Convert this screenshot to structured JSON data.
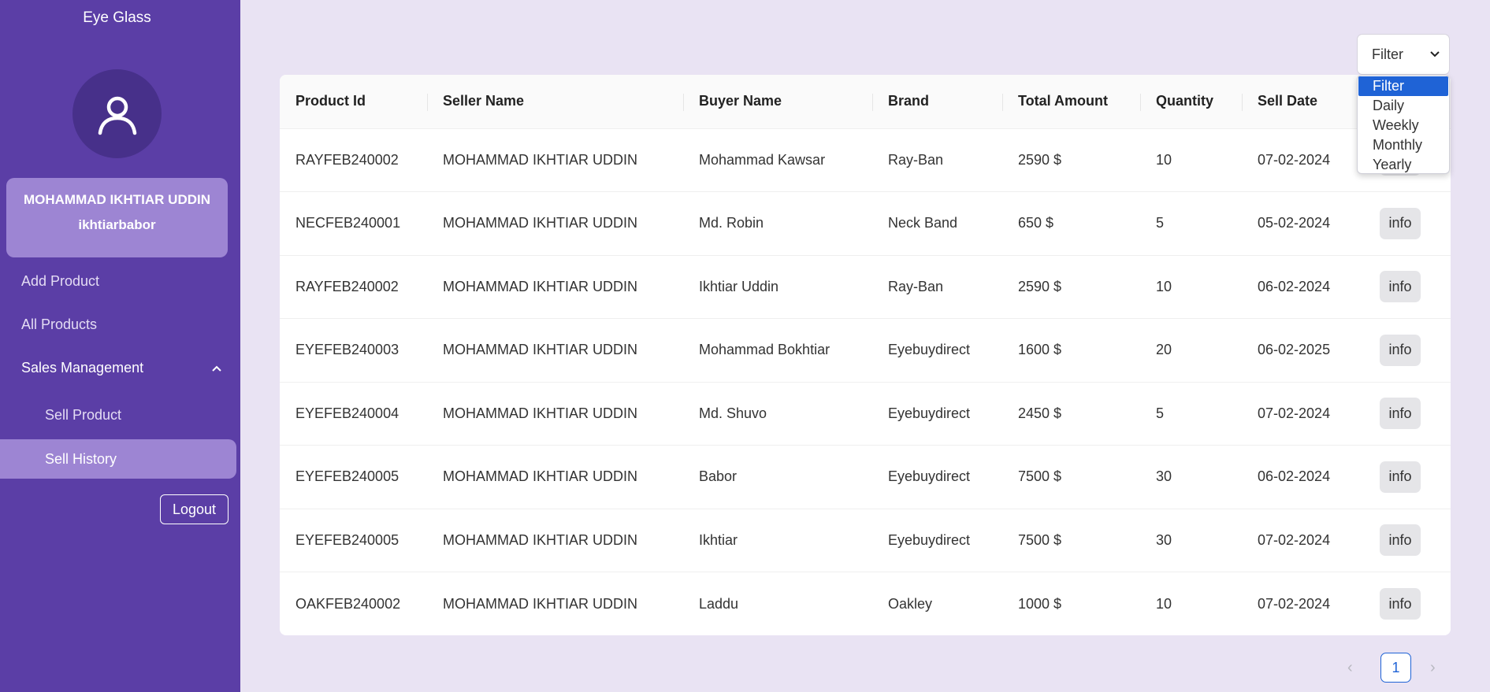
{
  "sidebar": {
    "brand": "Eye Glass",
    "user": {
      "name": "MOHAMMAD IKHTIAR UDDIN",
      "username": "ikhtiarbabor"
    },
    "nav": {
      "add_product": "Add Product",
      "all_products": "All Products",
      "sales_management": "Sales Management",
      "sell_product": "Sell Product",
      "sell_history": "Sell History"
    },
    "logout": "Logout"
  },
  "filter": {
    "selected": "Filter",
    "options": [
      "Filter",
      "Daily",
      "Weekly",
      "Monthly",
      "Yearly"
    ]
  },
  "table": {
    "columns": [
      "Product Id",
      "Seller Name",
      "Buyer Name",
      "Brand",
      "Total Amount",
      "Quantity",
      "Sell Date"
    ],
    "rows": [
      [
        "RAYFEB240002",
        "MOHAMMAD IKHTIAR UDDIN",
        "Mohammad Kawsar",
        "Ray-Ban",
        "2590 $",
        "10",
        "07-02-2024"
      ],
      [
        "NECFEB240001",
        "MOHAMMAD IKHTIAR UDDIN",
        "Md. Robin",
        "Neck Band",
        "650 $",
        "5",
        "05-02-2024"
      ],
      [
        "RAYFEB240002",
        "MOHAMMAD IKHTIAR UDDIN",
        "Ikhtiar Uddin",
        "Ray-Ban",
        "2590 $",
        "10",
        "06-02-2024"
      ],
      [
        "EYEFEB240003",
        "MOHAMMAD IKHTIAR UDDIN",
        "Mohammad Bokhtiar",
        "Eyebuydirect",
        "1600 $",
        "20",
        "06-02-2025"
      ],
      [
        "EYEFEB240004",
        "MOHAMMAD IKHTIAR UDDIN",
        "Md. Shuvo",
        "Eyebuydirect",
        "2450 $",
        "5",
        "07-02-2024"
      ],
      [
        "EYEFEB240005",
        "MOHAMMAD IKHTIAR UDDIN",
        "Babor",
        "Eyebuydirect",
        "7500 $",
        "30",
        "06-02-2024"
      ],
      [
        "EYEFEB240005",
        "MOHAMMAD IKHTIAR UDDIN",
        "Ikhtiar",
        "Eyebuydirect",
        "7500 $",
        "30",
        "07-02-2024"
      ],
      [
        "OAKFEB240002",
        "MOHAMMAD IKHTIAR UDDIN",
        "Laddu",
        "Oakley",
        "1000 $",
        "10",
        "07-02-2024"
      ]
    ],
    "info_label": "info"
  },
  "pagination": {
    "current": "1",
    "prev_icon": "chevron-left-icon",
    "next_icon": "chevron-right-icon"
  },
  "colors": {
    "sidebar": "#5b3ea6",
    "accent": "#9d85d3",
    "page_bg": "#e9e3f3",
    "primary": "#1f63d6"
  }
}
